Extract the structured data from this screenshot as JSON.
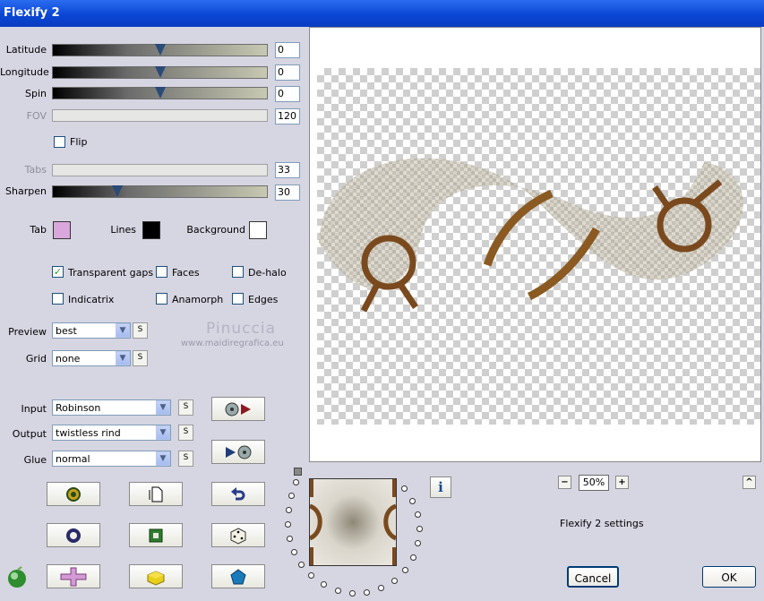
{
  "window": {
    "title": "Flexify 2"
  },
  "sliders": {
    "latitude": {
      "label": "Latitude",
      "value": "0",
      "level": 0.5
    },
    "longitude": {
      "label": "Longitude",
      "value": "0",
      "level": 0.5
    },
    "spin": {
      "label": "Spin",
      "value": "0",
      "level": 0.5
    },
    "fov": {
      "label": "FOV",
      "value": "120"
    },
    "tabs": {
      "label": "Tabs",
      "value": "33"
    },
    "sharpen": {
      "label": "Sharpen",
      "value": "30",
      "level": 0.3
    }
  },
  "flip": {
    "label": "Flip",
    "checked": false
  },
  "colors": {
    "tab": {
      "label": "Tab",
      "color": "#d9a7dc"
    },
    "lines": {
      "label": "Lines",
      "color": "#000000"
    },
    "background": {
      "label": "Background",
      "color": "#ffffff"
    }
  },
  "options": {
    "transparent_gaps": {
      "label": "Transparent gaps",
      "checked": true
    },
    "faces": {
      "label": "Faces",
      "checked": false
    },
    "de_halo": {
      "label": "De-halo",
      "checked": false
    },
    "indicatrix": {
      "label": "Indicatrix",
      "checked": false
    },
    "anamorph": {
      "label": "Anamorph",
      "checked": false
    },
    "edges": {
      "label": "Edges",
      "checked": false
    }
  },
  "selects": {
    "preview": {
      "label": "Preview",
      "value": "best"
    },
    "grid": {
      "label": "Grid",
      "value": "none"
    },
    "input": {
      "label": "Input",
      "value": "Robinson"
    },
    "output": {
      "label": "Output",
      "value": "twistless rind"
    },
    "glue": {
      "label": "Glue",
      "value": "normal"
    }
  },
  "s_button_label": "S",
  "watermark": {
    "name": "Pinuccia",
    "url": "www.maidiregrafica.eu"
  },
  "zoom": {
    "value": "50%",
    "minus": "−",
    "plus": "+"
  },
  "status_text": "Flexify 2 settings",
  "buttons": {
    "cancel": "Cancel",
    "ok": "OK",
    "info": "i",
    "up": "^"
  },
  "icons": [
    "camera-export-icon",
    "camera-import-icon",
    "load-preset-icon",
    "new-document-icon",
    "undo-icon",
    "ring-icon",
    "square-frame-icon",
    "dice-icon",
    "plugin-logo-icon",
    "cross-icon",
    "brick-icon",
    "pentagon-icon"
  ]
}
